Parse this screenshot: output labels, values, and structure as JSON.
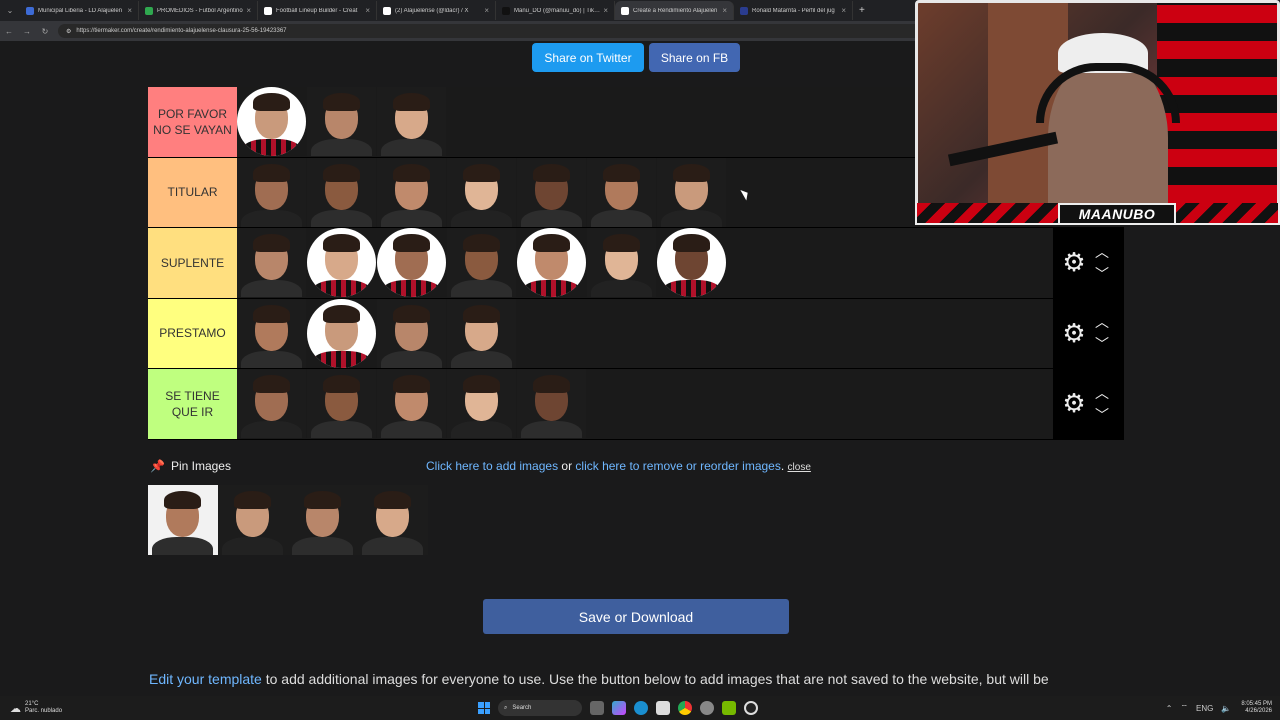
{
  "browser": {
    "tabs": [
      {
        "title": "Municipal Liberia - LD Alajuelen",
        "color": "#3d6bd6",
        "active": false
      },
      {
        "title": "PROMEDIOS - Futbol Argentino",
        "color": "#2fa84f",
        "active": false
      },
      {
        "title": "Football Lineup Builder - Creat",
        "color": "#ffffff",
        "active": false
      },
      {
        "title": "(2) Alajuelense (@ldacr) / X",
        "color": "#ffffff",
        "active": false
      },
      {
        "title": "Manu_DO (@manuu_do) | TikTo",
        "color": "#111111",
        "active": false
      },
      {
        "title": "Create a Rendimiento Alajuelen",
        "color": "#ffffff",
        "active": true
      },
      {
        "title": "Ronald Matarrita - Perfil del jug",
        "color": "#2a3c8f",
        "active": false
      }
    ],
    "new_tab": "+",
    "url": "https://tiermaker.com/create/rendimiento-alajuelense-clausura-25-56-19423367"
  },
  "share": {
    "twitter": "Share on Twitter",
    "facebook": "Share on FB"
  },
  "tiers": [
    {
      "label": "POR FAVOR NO SE VAYAN",
      "color": "#ff7f7f",
      "count": 3,
      "settings": false
    },
    {
      "label": "TITULAR",
      "color": "#ffbf7f",
      "count": 7,
      "settings": false
    },
    {
      "label": "SUPLENTE",
      "color": "#ffdf7f",
      "count": 7,
      "settings": true
    },
    {
      "label": "PRESTAMO",
      "color": "#ffff7f",
      "count": 4,
      "settings": true
    },
    {
      "label": "SE TIENE QUE IR",
      "color": "#bfff7f",
      "count": 5,
      "settings": true
    }
  ],
  "pin": {
    "label": "Pin Images",
    "add_link": "Click here to add images",
    "or": " or ",
    "remove_link": "click here to remove or reorder images",
    "period": ".",
    "close": "close"
  },
  "pinned_count": 4,
  "save_button": "Save or Download",
  "edit": {
    "link": "Edit your template",
    "text": " to add additional images for everyone to use. Use the button below to add images that are not saved to the website, but will be"
  },
  "webcam": {
    "name": "MAANUBO"
  },
  "taskbar": {
    "temp": "21°C",
    "weather": "Parc. nublado",
    "search": "Search",
    "lang": "ENG",
    "time": "8:05:45 PM",
    "date": "4/26/2026"
  }
}
